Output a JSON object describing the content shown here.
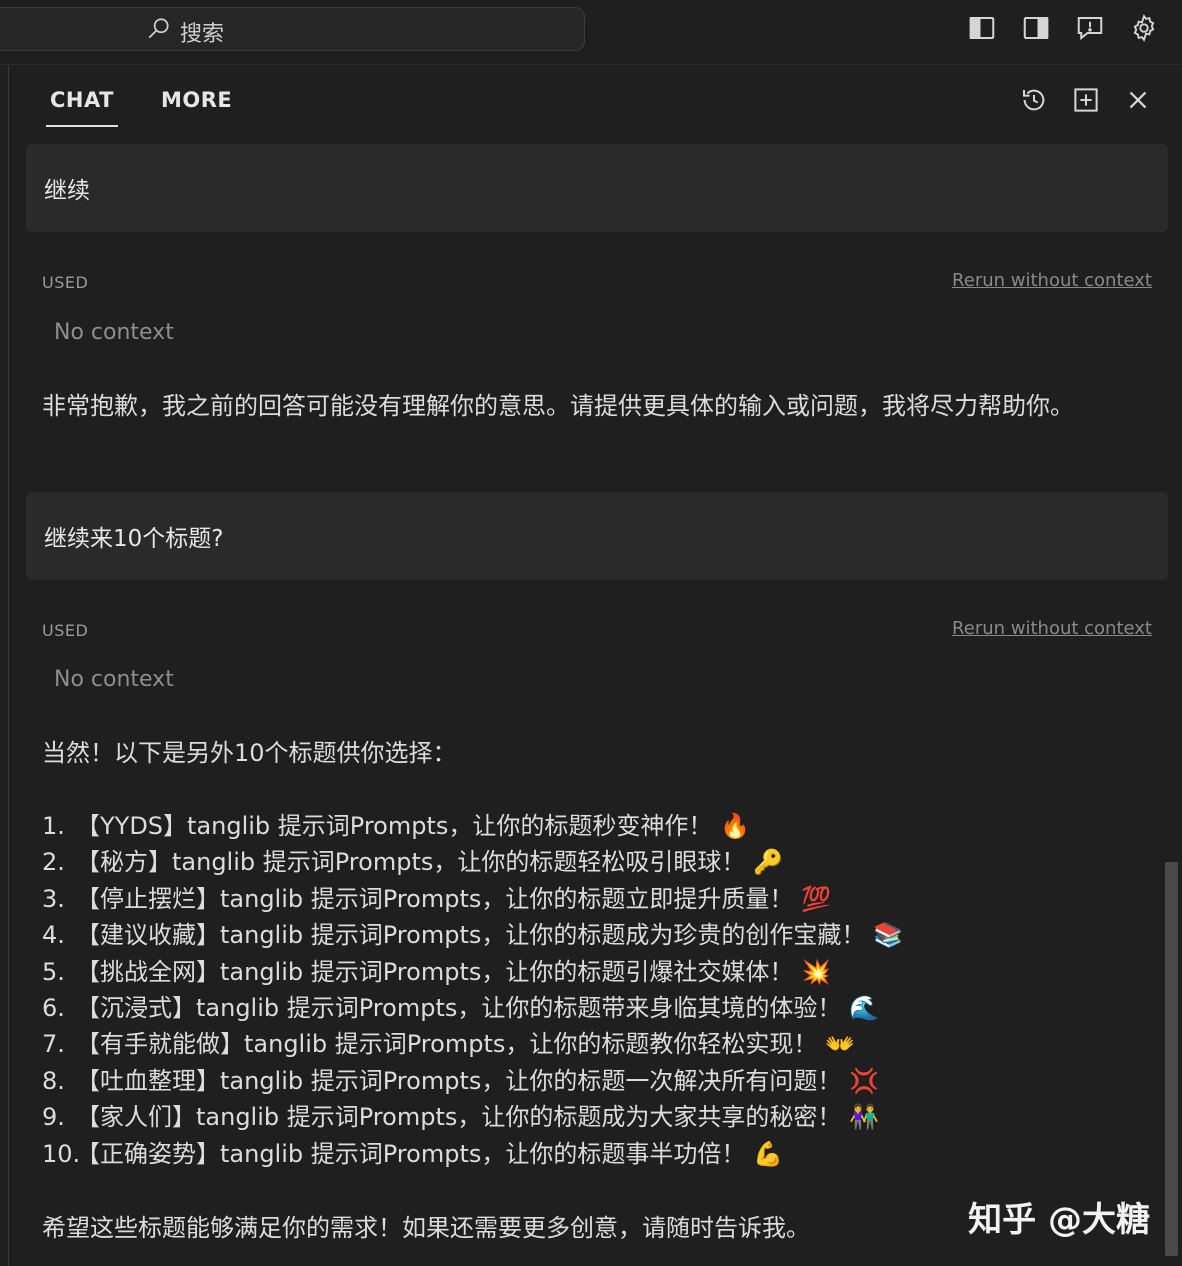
{
  "topbar": {
    "search_placeholder": "搜索",
    "icons": [
      "toggle-primary-sidebar-icon",
      "toggle-secondary-sidebar-icon",
      "feedback-icon",
      "settings-gear-icon"
    ]
  },
  "panel": {
    "tabs": [
      {
        "label": "CHAT",
        "active": true
      },
      {
        "label": "MORE",
        "active": false
      }
    ],
    "icons": [
      "history-icon",
      "new-chat-icon",
      "close-icon"
    ]
  },
  "messages": [
    {
      "user": "继续",
      "used_label": "USED",
      "rerun_label": "Rerun without context",
      "context": "No context",
      "answer": "非常抱歉，我之前的回答可能没有理解你的意思。请提供更具体的输入或问题，我将尽力帮助你。"
    },
    {
      "user": "继续来10个标题?",
      "used_label": "USED",
      "rerun_label": "Rerun without context",
      "context": "No context",
      "answer_intro": "当然！以下是另外10个标题供你选择：",
      "items": [
        {
          "num": "1.",
          "text": "【YYDS】tanglib 提示词Prompts，让你的标题秒变神作！",
          "emoji": "🔥"
        },
        {
          "num": "2.",
          "text": "【秘方】tanglib 提示词Prompts，让你的标题轻松吸引眼球！",
          "emoji": "🔑"
        },
        {
          "num": "3.",
          "text": "【停止摆烂】tanglib 提示词Prompts，让你的标题立即提升质量！",
          "emoji": "💯"
        },
        {
          "num": "4.",
          "text": "【建议收藏】tanglib 提示词Prompts，让你的标题成为珍贵的创作宝藏！",
          "emoji": "📚"
        },
        {
          "num": "5.",
          "text": "【挑战全网】tanglib 提示词Prompts，让你的标题引爆社交媒体！",
          "emoji": "💥"
        },
        {
          "num": "6.",
          "text": "【沉浸式】tanglib 提示词Prompts，让你的标题带来身临其境的体验！",
          "emoji": "🌊"
        },
        {
          "num": "7.",
          "text": "【有手就能做】tanglib 提示词Prompts，让你的标题教你轻松实现！",
          "emoji": "👐"
        },
        {
          "num": "8.",
          "text": "【吐血整理】tanglib 提示词Prompts，让你的标题一次解决所有问题！",
          "emoji": "💢"
        },
        {
          "num": "9.",
          "text": "【家人们】tanglib 提示词Prompts，让你的标题成为大家共享的秘密！",
          "emoji": "👫"
        },
        {
          "num": "10.",
          "text": "【正确姿势】tanglib 提示词Prompts，让你的标题事半功倍！",
          "emoji": "💪"
        }
      ],
      "answer_outro": "希望这些标题能够满足你的需求！如果还需要更多创意，请随时告诉我。"
    }
  ],
  "watermark": "知乎 @大糖"
}
